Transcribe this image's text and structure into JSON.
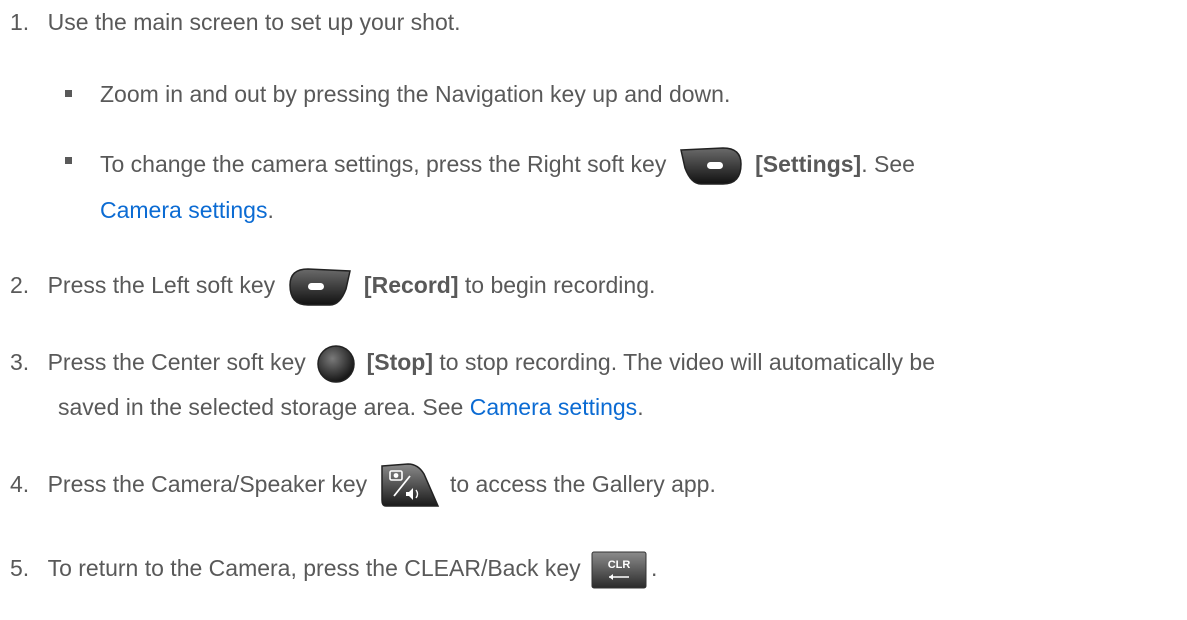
{
  "steps": [
    {
      "number": "1.",
      "text": "Use the main screen to set up your shot.",
      "bullets": [
        {
          "text": "Zoom in and out by pressing the Navigation key up and down."
        },
        {
          "text_before": "To change the camera settings, press the Right soft key",
          "key_icon": "right-soft-key-icon",
          "bold": "[Settings]",
          "text_after": ". See",
          "link": "Camera settings",
          "end": "."
        }
      ]
    },
    {
      "number": "2.",
      "text_before": "Press the Left soft key",
      "key_icon": "left-soft-key-icon",
      "bold": "[Record]",
      "text_after": "to begin recording."
    },
    {
      "number": "3.",
      "text_before": "Press the Center soft key",
      "key_icon": "center-soft-key-icon",
      "bold": "[Stop]",
      "text_after": "to stop recording. The video will automatically be",
      "line2_before": "saved in the selected storage area. See",
      "link": "Camera settings",
      "end": "."
    },
    {
      "number": "4.",
      "text_before": "Press the Camera/Speaker key",
      "key_icon": "camera-speaker-key-icon",
      "text_after": "to access the Gallery app."
    },
    {
      "number": "5.",
      "text_before": "To return to the Camera, press the CLEAR/Back key",
      "key_icon": "clear-back-key-icon",
      "key_label": "CLR",
      "end": "."
    }
  ],
  "colors": {
    "text": "#595959",
    "link": "#0b6bd3"
  }
}
